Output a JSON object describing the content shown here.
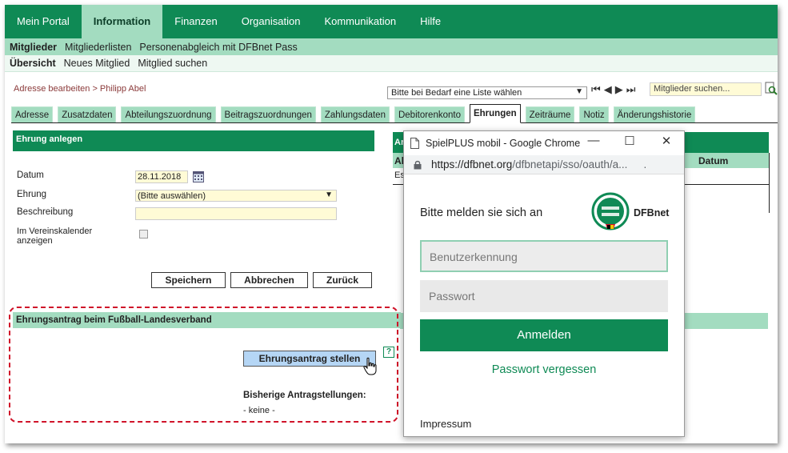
{
  "top_nav": [
    {
      "label": "Mein Portal",
      "active": false
    },
    {
      "label": "Information",
      "active": true
    },
    {
      "label": "Finanzen",
      "active": false
    },
    {
      "label": "Organisation",
      "active": false
    },
    {
      "label": "Kommunikation",
      "active": false
    },
    {
      "label": "Hilfe",
      "active": false
    }
  ],
  "sub_nav1": [
    "Mitglieder",
    "Mitgliederlisten",
    "Personenabgleich mit DFBnet Pass"
  ],
  "sub_nav2": [
    "Übersicht",
    "Neues Mitglied",
    "Mitglied suchen"
  ],
  "toolbar": {
    "breadcrumb": "Adresse bearbeiten > Philipp Abel",
    "list_select": "Bitte bei Bedarf eine Liste wählen",
    "member_search_placeholder": "Mitglieder suchen..."
  },
  "tabs": [
    {
      "label": "Adresse",
      "active": false
    },
    {
      "label": "Zusatzdaten",
      "active": false
    },
    {
      "label": "Abteilungszuordnung",
      "active": false
    },
    {
      "label": "Beitragszuordnungen",
      "active": false
    },
    {
      "label": "Zahlungsdaten",
      "active": false
    },
    {
      "label": "Debitorenkonto",
      "active": false
    },
    {
      "label": "Ehrungen",
      "active": true
    },
    {
      "label": "Zeiträume",
      "active": false
    },
    {
      "label": "Notiz",
      "active": false
    },
    {
      "label": "Änderungshistorie",
      "active": false
    }
  ],
  "form": {
    "header": "Ehrung anlegen",
    "date_label": "Datum",
    "date_value": "28.11.2018",
    "honor_label": "Ehrung",
    "honor_value": "(Bitte auswählen)",
    "description_label": "Beschreibung",
    "calendar_label": "Im Vereinskalender anzeigen",
    "save": "Speichern",
    "cancel": "Abbrechen",
    "back": "Zurück"
  },
  "application": {
    "header": "Ehrungsantrag beim Fußball-Landesverband",
    "button": "Ehrungsantrag stellen",
    "help": "?",
    "previous_label": "Bisherige Antragstellungen:",
    "previous_value": "- keine -"
  },
  "right_panel": {
    "header_fragment": "Ar",
    "col_fragment": "Al",
    "row_fragment": "Es",
    "col_date": "Datum"
  },
  "popup": {
    "title": "SpielPLUS mobil - Google Chrome",
    "minimize": "—",
    "maximize": "☐",
    "close": "✕",
    "url_host": "https://dfbnet.org",
    "url_path": "/dfbnetapi/sso/oauth/a...",
    "url_end": ".",
    "login_title": "Bitte melden sie sich an",
    "brand": "DFBnet",
    "username_placeholder": "Benutzerkennung",
    "password_placeholder": "Passwort",
    "login_button": "Anmelden",
    "forgot": "Passwort vergessen",
    "imprint": "Impressum"
  },
  "colors": {
    "brand_green": "#0f8a55",
    "light_green": "#a3dcc0",
    "highlight_red": "#d0142a"
  }
}
